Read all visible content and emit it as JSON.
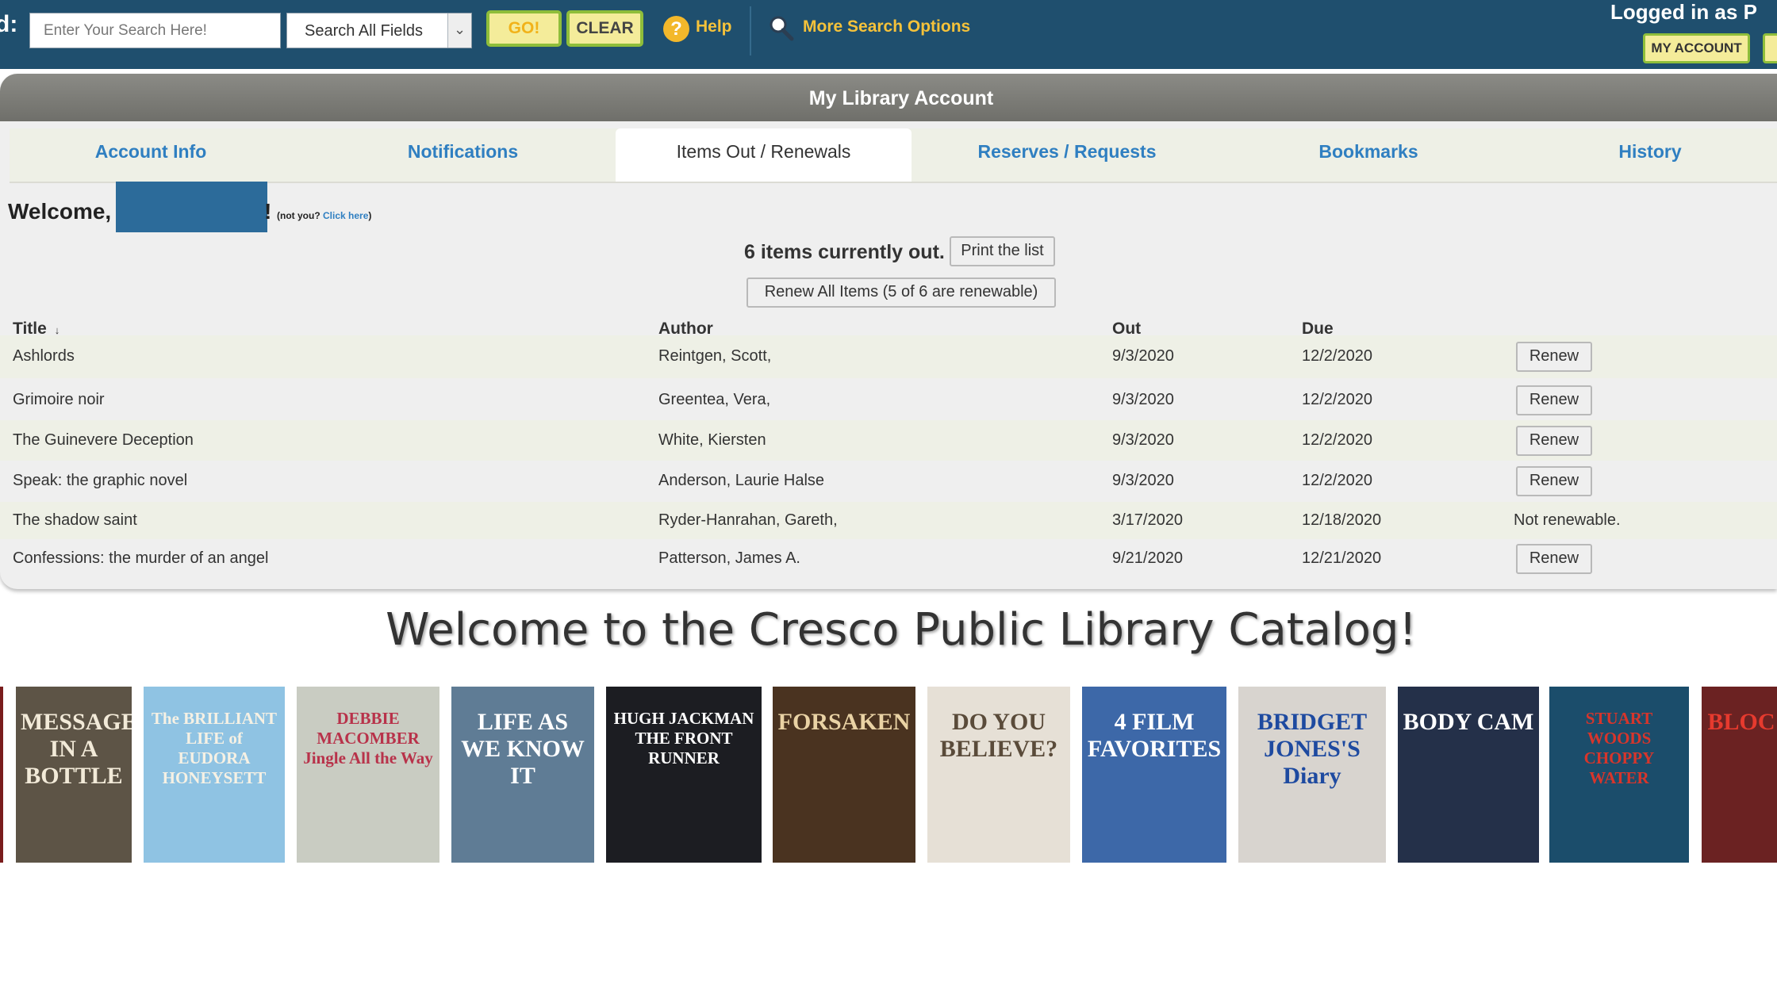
{
  "topbar": {
    "find_label": "d:",
    "search_placeholder": "Enter Your Search Here!",
    "field_select": "Search All Fields",
    "go_label": "GO!",
    "clear_label": "CLEAR",
    "help_label": "Help",
    "more_options_label": "More Search Options",
    "logged_in": "Logged in as P",
    "my_account_label": "MY ACCOUNT"
  },
  "panel": {
    "title": "My Library Account",
    "tabs": [
      {
        "label": "Account Info",
        "active": false
      },
      {
        "label": "Notifications",
        "active": false
      },
      {
        "label": "Items Out / Renewals",
        "active": true
      },
      {
        "label": "Reserves / Requests",
        "active": false
      },
      {
        "label": "Bookmarks",
        "active": false
      },
      {
        "label": "History",
        "active": false
      }
    ],
    "welcome": "Welcome,",
    "welcome_end": "!",
    "not_you": "(not you?",
    "click_here": "Click here",
    "close_paren": ")",
    "items_count": "6 items currently out.",
    "print_label": "Print the list",
    "renew_all_label": "Renew All Items (5 of 6 are renewable)"
  },
  "table": {
    "headers": {
      "title": "Title",
      "sort_arrow": "↓",
      "author": "Author",
      "out": "Out",
      "due": "Due"
    },
    "rows": [
      {
        "title": "Ashlords",
        "author": "Reintgen, Scott,",
        "out": "9/3/2020",
        "due": "12/2/2020",
        "action": "Renew",
        "renewable": true
      },
      {
        "title": "Grimoire noir",
        "author": "Greentea, Vera,",
        "out": "9/3/2020",
        "due": "12/2/2020",
        "action": "Renew",
        "renewable": true
      },
      {
        "title": "The Guinevere Deception",
        "author": "White, Kiersten",
        "out": "9/3/2020",
        "due": "12/2/2020",
        "action": "Renew",
        "renewable": true
      },
      {
        "title": "Speak: the graphic novel",
        "author": "Anderson, Laurie Halse",
        "out": "9/3/2020",
        "due": "12/2/2020",
        "action": "Renew",
        "renewable": true
      },
      {
        "title": "The shadow saint",
        "author": "Ryder-Hanrahan, Gareth,",
        "out": "3/17/2020",
        "due": "12/18/2020",
        "action": "Not renewable.",
        "renewable": false
      },
      {
        "title": "Confessions: the murder of an angel",
        "author": "Patterson, James A.",
        "out": "9/21/2020",
        "due": "12/21/2020",
        "action": "Renew",
        "renewable": true
      }
    ]
  },
  "catalog": {
    "title": "Welcome to the Cresco Public Library Catalog!",
    "covers": [
      {
        "text": "",
        "bg": "#7a1d1d",
        "fg": "#ffffff"
      },
      {
        "text": "MESSAGE IN A BOTTLE",
        "bg": "#5d5446",
        "fg": "#f2ead8"
      },
      {
        "text": "The BRILLIANT LIFE of EUDORA HONEYSETT",
        "bg": "#8fc3e3",
        "fg": "#f6f1e4"
      },
      {
        "text": "DEBBIE MACOMBER Jingle All the Way",
        "bg": "#c9ccc2",
        "fg": "#b8324a"
      },
      {
        "text": "LIFE AS WE KNOW IT",
        "bg": "#5f7c95",
        "fg": "#ffffff"
      },
      {
        "text": "HUGH JACKMAN THE FRONT RUNNER",
        "bg": "#1c1d22",
        "fg": "#ffffff"
      },
      {
        "text": "FORSAKEN",
        "bg": "#4a3320",
        "fg": "#e9d2a4"
      },
      {
        "text": "DO YOU BELIEVE?",
        "bg": "#e6e0d6",
        "fg": "#5a4b3a"
      },
      {
        "text": "4 FILM FAVORITES",
        "bg": "#3d68a8",
        "fg": "#ffffff"
      },
      {
        "text": "BRIDGET JONES'S Diary",
        "bg": "#d8d4cf",
        "fg": "#1e4aa0"
      },
      {
        "text": "BODY CAM",
        "bg": "#243049",
        "fg": "#ffffff"
      },
      {
        "text": "STUART WOODS CHOPPY WATER",
        "bg": "#1b4d6b",
        "fg": "#d8352b"
      },
      {
        "text": "BLOC",
        "bg": "#6b2222",
        "fg": "#e63a2e"
      }
    ]
  }
}
